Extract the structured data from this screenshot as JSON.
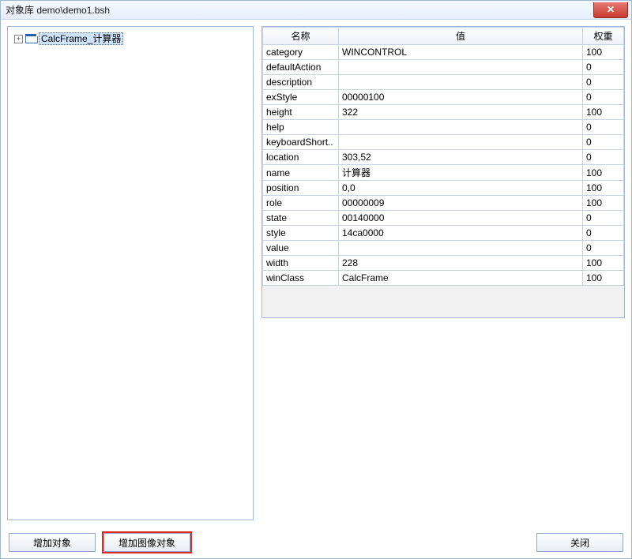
{
  "window": {
    "title": "对象库  demo\\demo1.bsh",
    "close_glyph": "✕"
  },
  "tree": {
    "toggle_glyph": "+",
    "items": [
      {
        "label": "CalcFrame_计算器",
        "selected": true
      }
    ]
  },
  "grid": {
    "headers": {
      "name": "名称",
      "value": "值",
      "weight": "权重"
    },
    "rows": [
      {
        "name": "category",
        "value": "WINCONTROL",
        "weight": "100"
      },
      {
        "name": "defaultAction",
        "value": "",
        "weight": "0"
      },
      {
        "name": "description",
        "value": "",
        "weight": "0"
      },
      {
        "name": "exStyle",
        "value": "00000100",
        "weight": "0"
      },
      {
        "name": "height",
        "value": "322",
        "weight": "100"
      },
      {
        "name": "help",
        "value": "",
        "weight": "0"
      },
      {
        "name": "keyboardShort..",
        "value": "",
        "weight": "0"
      },
      {
        "name": "location",
        "value": "303,52",
        "weight": "0"
      },
      {
        "name": "name",
        "value": "计算器",
        "weight": "100"
      },
      {
        "name": "position",
        "value": "0,0",
        "weight": "100"
      },
      {
        "name": "role",
        "value": "00000009",
        "weight": "100"
      },
      {
        "name": "state",
        "value": "00140000",
        "weight": "0"
      },
      {
        "name": "style",
        "value": "14ca0000",
        "weight": "0"
      },
      {
        "name": "value",
        "value": "",
        "weight": "0"
      },
      {
        "name": "width",
        "value": "228",
        "weight": "100"
      },
      {
        "name": "winClass",
        "value": "CalcFrame",
        "weight": "100"
      }
    ]
  },
  "buttons": {
    "add_object": "增加对象",
    "add_image_object": "增加图像对象",
    "close": "关闭"
  }
}
